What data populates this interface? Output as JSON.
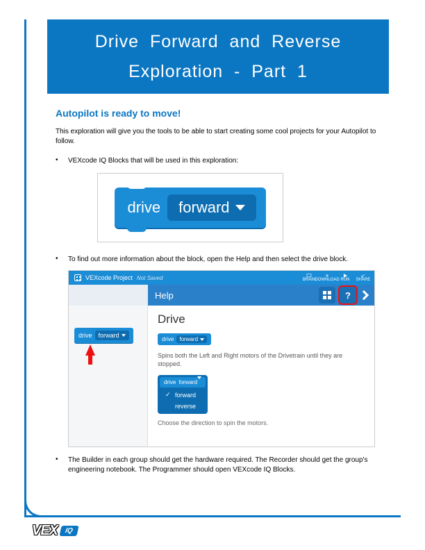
{
  "title": {
    "line1": "Drive  Forward  and  Reverse",
    "line2": "Exploration  -  Part  1"
  },
  "heading": "Autopilot is ready to move!",
  "intro": "This exploration will give you the tools to be able to start creating some cool projects for your Autopilot to follow.",
  "bullets": {
    "b1": "VEXcode IQ Blocks that will be used in this exploration:",
    "b2": "To find out more information about the block, open the Help and then select the drive block.",
    "b3": "The Builder in each group should get the hardware required. The Recorder should get the group's engineering notebook. The Programmer should open VEXcode IQ Blocks."
  },
  "block1": {
    "drive": "drive",
    "forward": "forward"
  },
  "fig2": {
    "project_name": "VEXcode Project",
    "not_saved": "Not Saved",
    "toolbar": {
      "brain": "BRAIN",
      "download": "DOWNLOAD",
      "run": "RUN",
      "share": "SHARE"
    },
    "help_label": "Help",
    "panel_title": "Drive",
    "mini": {
      "drive": "drive",
      "forward": "forward"
    },
    "desc": "Spins both the Left and Right motors of the Drivetrain until they are stopped.",
    "opts": {
      "forward": "forward",
      "reverse": "reverse"
    },
    "sub": "Choose the direction to spin the motors."
  },
  "footer": {
    "vex": "VEX",
    "iq": "IQ"
  }
}
